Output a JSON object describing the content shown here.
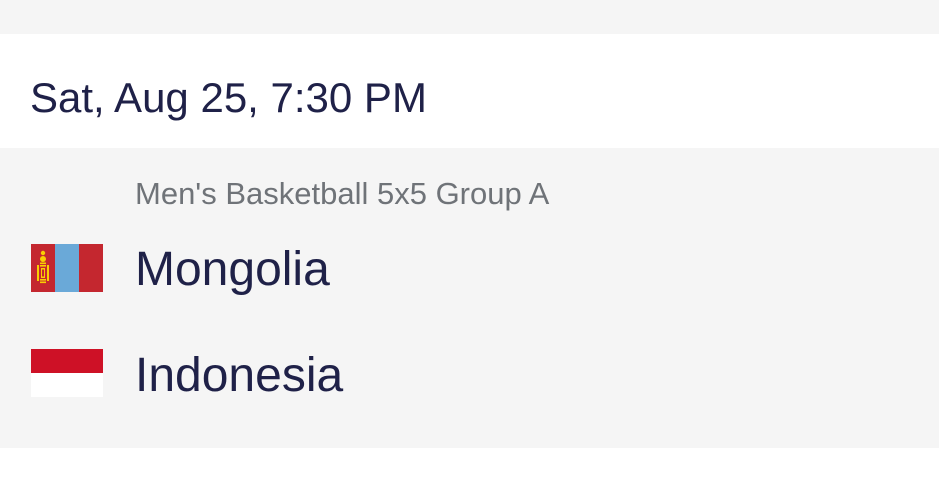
{
  "header": {
    "datetime": "Sat, Aug 25, 7:30 PM"
  },
  "event": {
    "title": "Men's Basketball 5x5 Group A",
    "teams": [
      {
        "name": "Mongolia",
        "flag": "mongolia-flag",
        "colors": [
          "#c4272f",
          "#6aa9d8",
          "#f9cf02"
        ]
      },
      {
        "name": "Indonesia",
        "flag": "indonesia-flag",
        "colors": [
          "#ce1126",
          "#ffffff"
        ]
      }
    ]
  },
  "colors": {
    "text_primary": "#1f2148",
    "text_secondary": "#6f7378",
    "card_background": "#f5f5f5"
  }
}
